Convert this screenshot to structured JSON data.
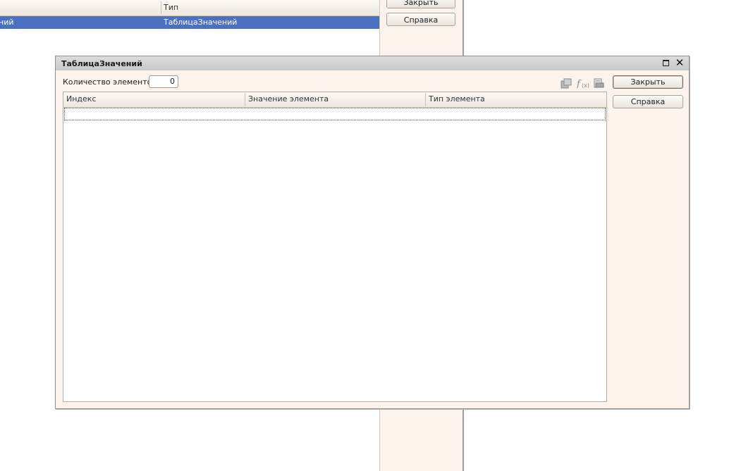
{
  "background_window": {
    "column_type": "Тип",
    "row_name_fragment": "ний",
    "row_type": "ТаблицаЗначений",
    "close_button": "Закрыть",
    "help_button": "Справка"
  },
  "dialog": {
    "title": "ТаблицаЗначений",
    "count_label": "Количество элементов:",
    "count_value": "0",
    "toolbar_icons": [
      "copy-icon",
      "formula-icon",
      "print-preview-icon"
    ],
    "columns": [
      "Индекс",
      "Значение элемента",
      "Тип элемента"
    ],
    "close_button": "Закрыть",
    "help_button": "Справка"
  },
  "colors": {
    "selection": "#4b6fc1",
    "window_bg": "#fbf3ec",
    "titlebar": "#c8c8c8"
  }
}
